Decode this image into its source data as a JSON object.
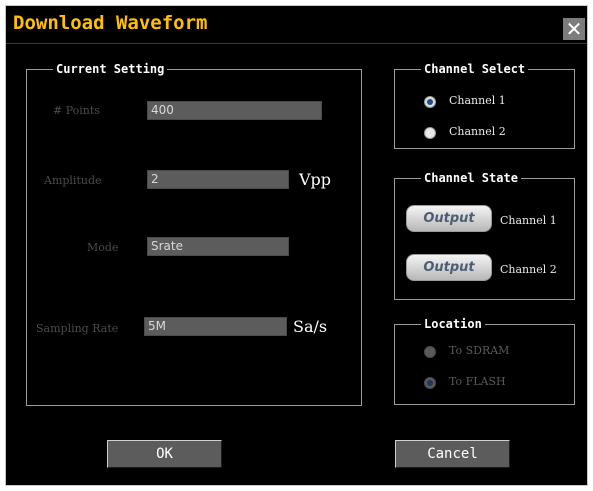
{
  "window": {
    "title": "Download Waveform",
    "close_glyph": "✕"
  },
  "current_setting": {
    "legend": "Current Setting",
    "points_label": "# Points",
    "points_value": "400",
    "amplitude_label": "Amplitude",
    "amplitude_value": "2",
    "amplitude_unit": "Vpp",
    "mode_label": "Mode",
    "mode_value": "Srate",
    "sampling_label": "Sampling Rate",
    "sampling_value": "5M",
    "sampling_unit": "Sa/s"
  },
  "channel_select": {
    "legend": "Channel Select",
    "options": [
      {
        "label": "Channel 1",
        "selected": true
      },
      {
        "label": "Channel 2",
        "selected": false
      }
    ]
  },
  "channel_state": {
    "legend": "Channel State",
    "rows": [
      {
        "button": "Output",
        "label": "Channel 1"
      },
      {
        "button": "Output",
        "label": "Channel 2"
      }
    ]
  },
  "location": {
    "legend": "Location",
    "options": [
      {
        "label": "To SDRAM",
        "selected": false,
        "enabled": false
      },
      {
        "label": "To FLASH",
        "selected": true,
        "enabled": false
      }
    ]
  },
  "buttons": {
    "ok": "OK",
    "cancel": "Cancel"
  },
  "colors": {
    "title": "#ffc000",
    "background": "#000000",
    "field": "#5c5c5c"
  }
}
